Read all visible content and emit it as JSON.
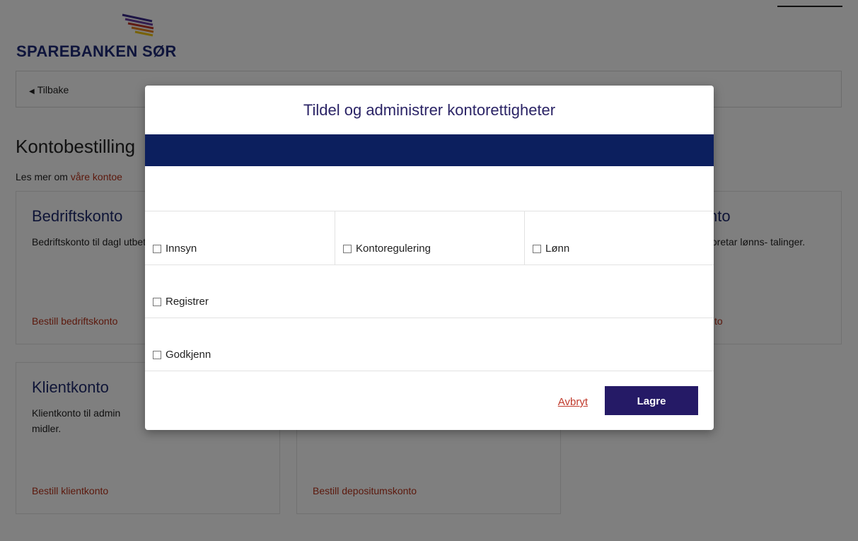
{
  "brand": {
    "name": "SPAREBANKEN SØR"
  },
  "nav": {
    "back_label": "Tilbake"
  },
  "page": {
    "title": "Kontobestilling",
    "intro_prefix": "Les mer om ",
    "intro_link": "våre kontoe"
  },
  "cards": [
    {
      "title": "Bedriftskonto",
      "desc": "Bedriftskonto til dagl utbetalinger.",
      "link": "Bestill bedriftskonto"
    },
    {
      "title": "nto",
      "desc": "foretar lønns- talinger.",
      "link": "to"
    },
    {
      "title": "Klientkonto",
      "desc": "Klientkonto til admin midler.",
      "link": "Bestill klientkonto"
    },
    {
      "title": "",
      "desc": "",
      "link": "Bestill depositumskonto"
    }
  ],
  "modal": {
    "title": "Tildel og administrer kontorettigheter",
    "options": {
      "innsyn": "Innsyn",
      "kontoregulering": "Kontoregulering",
      "lonn": "Lønn",
      "registrer": "Registrer",
      "godkjenn": "Godkjenn"
    },
    "cancel_label": "Avbryt",
    "save_label": "Lagre"
  },
  "colors": {
    "brand_blue": "#1e2a78",
    "modal_band": "#0c1f5e",
    "save_button": "#251a66",
    "link_red": "#b8321a"
  }
}
